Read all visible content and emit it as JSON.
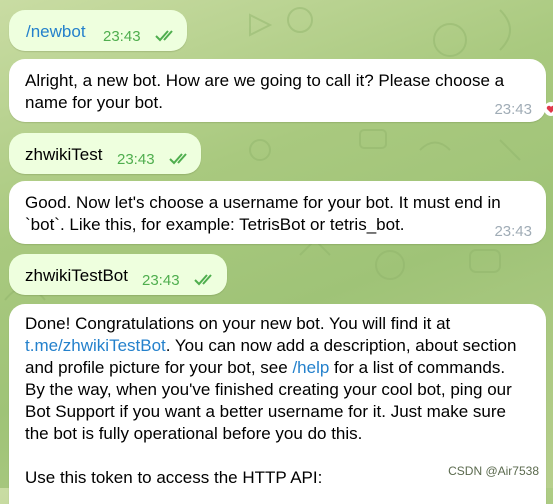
{
  "chat": {
    "messages": [
      {
        "text": "/newbot",
        "time": "23:43"
      },
      {
        "text1": "Alright, a new bot. How are we going to call it? Please choose a",
        "text2": "name for your bot.",
        "time": "23:43"
      },
      {
        "text": "zhwikiTest",
        "time": "23:43"
      },
      {
        "text1": "Good. Now let's choose a username for your bot. It must end in",
        "text2": "`bot`. Like this, for example: TetrisBot or tetris_bot.",
        "time": "23:43"
      },
      {
        "text": "zhwikiTestBot",
        "time": "23:43"
      },
      {
        "l1": "Done! Congratulations on your new bot. You will find it at",
        "l2_link": "t.me/zhwikiTestBot",
        "l2_rest": ". You can now add a description, about section",
        "l3_a": "and profile picture for your bot, see ",
        "l3_link": "/help",
        "l3_b": " for a list of commands.",
        "l4": "By the way, when you've finished creating your cool bot, ping our",
        "l5": "Bot Support if you want a better username for it. Just make sure",
        "l6": "the bot is fully operational before you do this.",
        "l7": "Use this token to access the HTTP API:"
      }
    ]
  },
  "watermark": "CSDN @Air7538",
  "colors": {
    "outgoing_bubble": "#eeffde",
    "incoming_bubble": "#ffffff",
    "link": "#2481cc",
    "read_check": "#4fae4e"
  }
}
